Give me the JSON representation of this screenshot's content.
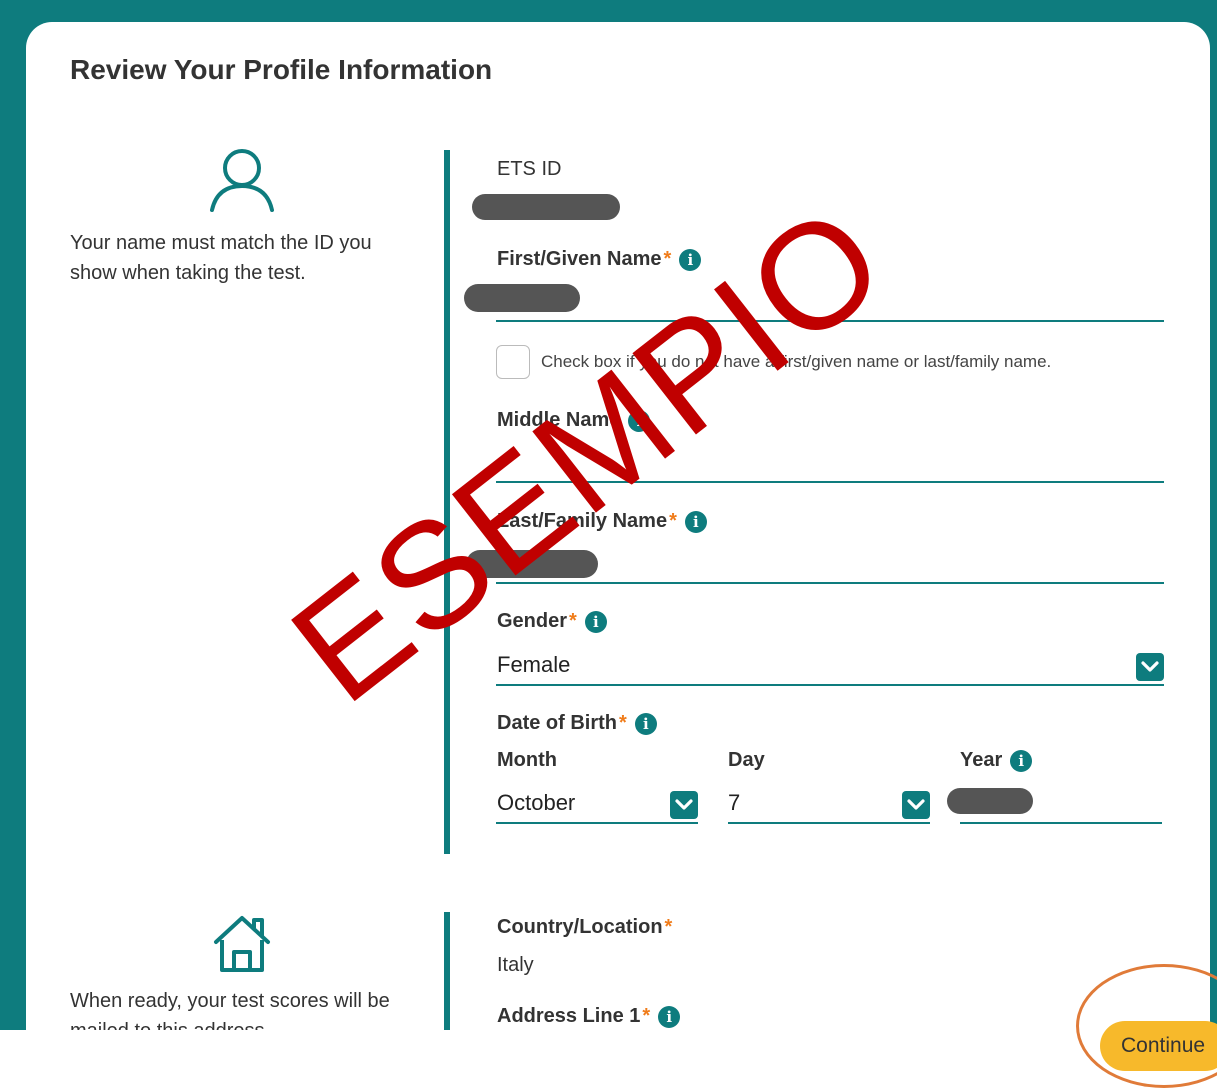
{
  "page": {
    "title": "Review Your Profile Information",
    "name_note": "Your name must match the ID you show when taking the test.",
    "address_note": "When ready, your test scores will be mailed to this address."
  },
  "fields": {
    "ets_id_label": "ETS ID",
    "first_name_label": "First/Given Name",
    "no_name_checkbox_label": "Check box if you do not have a first/given name or last/family name.",
    "middle_name_label": "Middle Name",
    "last_name_label": "Last/Family Name",
    "gender_label": "Gender",
    "gender_value": "Female",
    "dob_label": "Date of Birth",
    "month_label": "Month",
    "day_label": "Day",
    "year_label": "Year",
    "month_value": "October",
    "day_value": "7",
    "country_label": "Country/Location",
    "country_value": "Italy",
    "address1_label": "Address Line 1"
  },
  "required_marker": "*",
  "info_glyph": "i",
  "continue_label": "Continue",
  "watermark": "ESEMPIO",
  "colors": {
    "teal": "#0e7c7e",
    "accent": "#f07c1a",
    "button": "#f7b92b",
    "watermark": "#c00000"
  }
}
